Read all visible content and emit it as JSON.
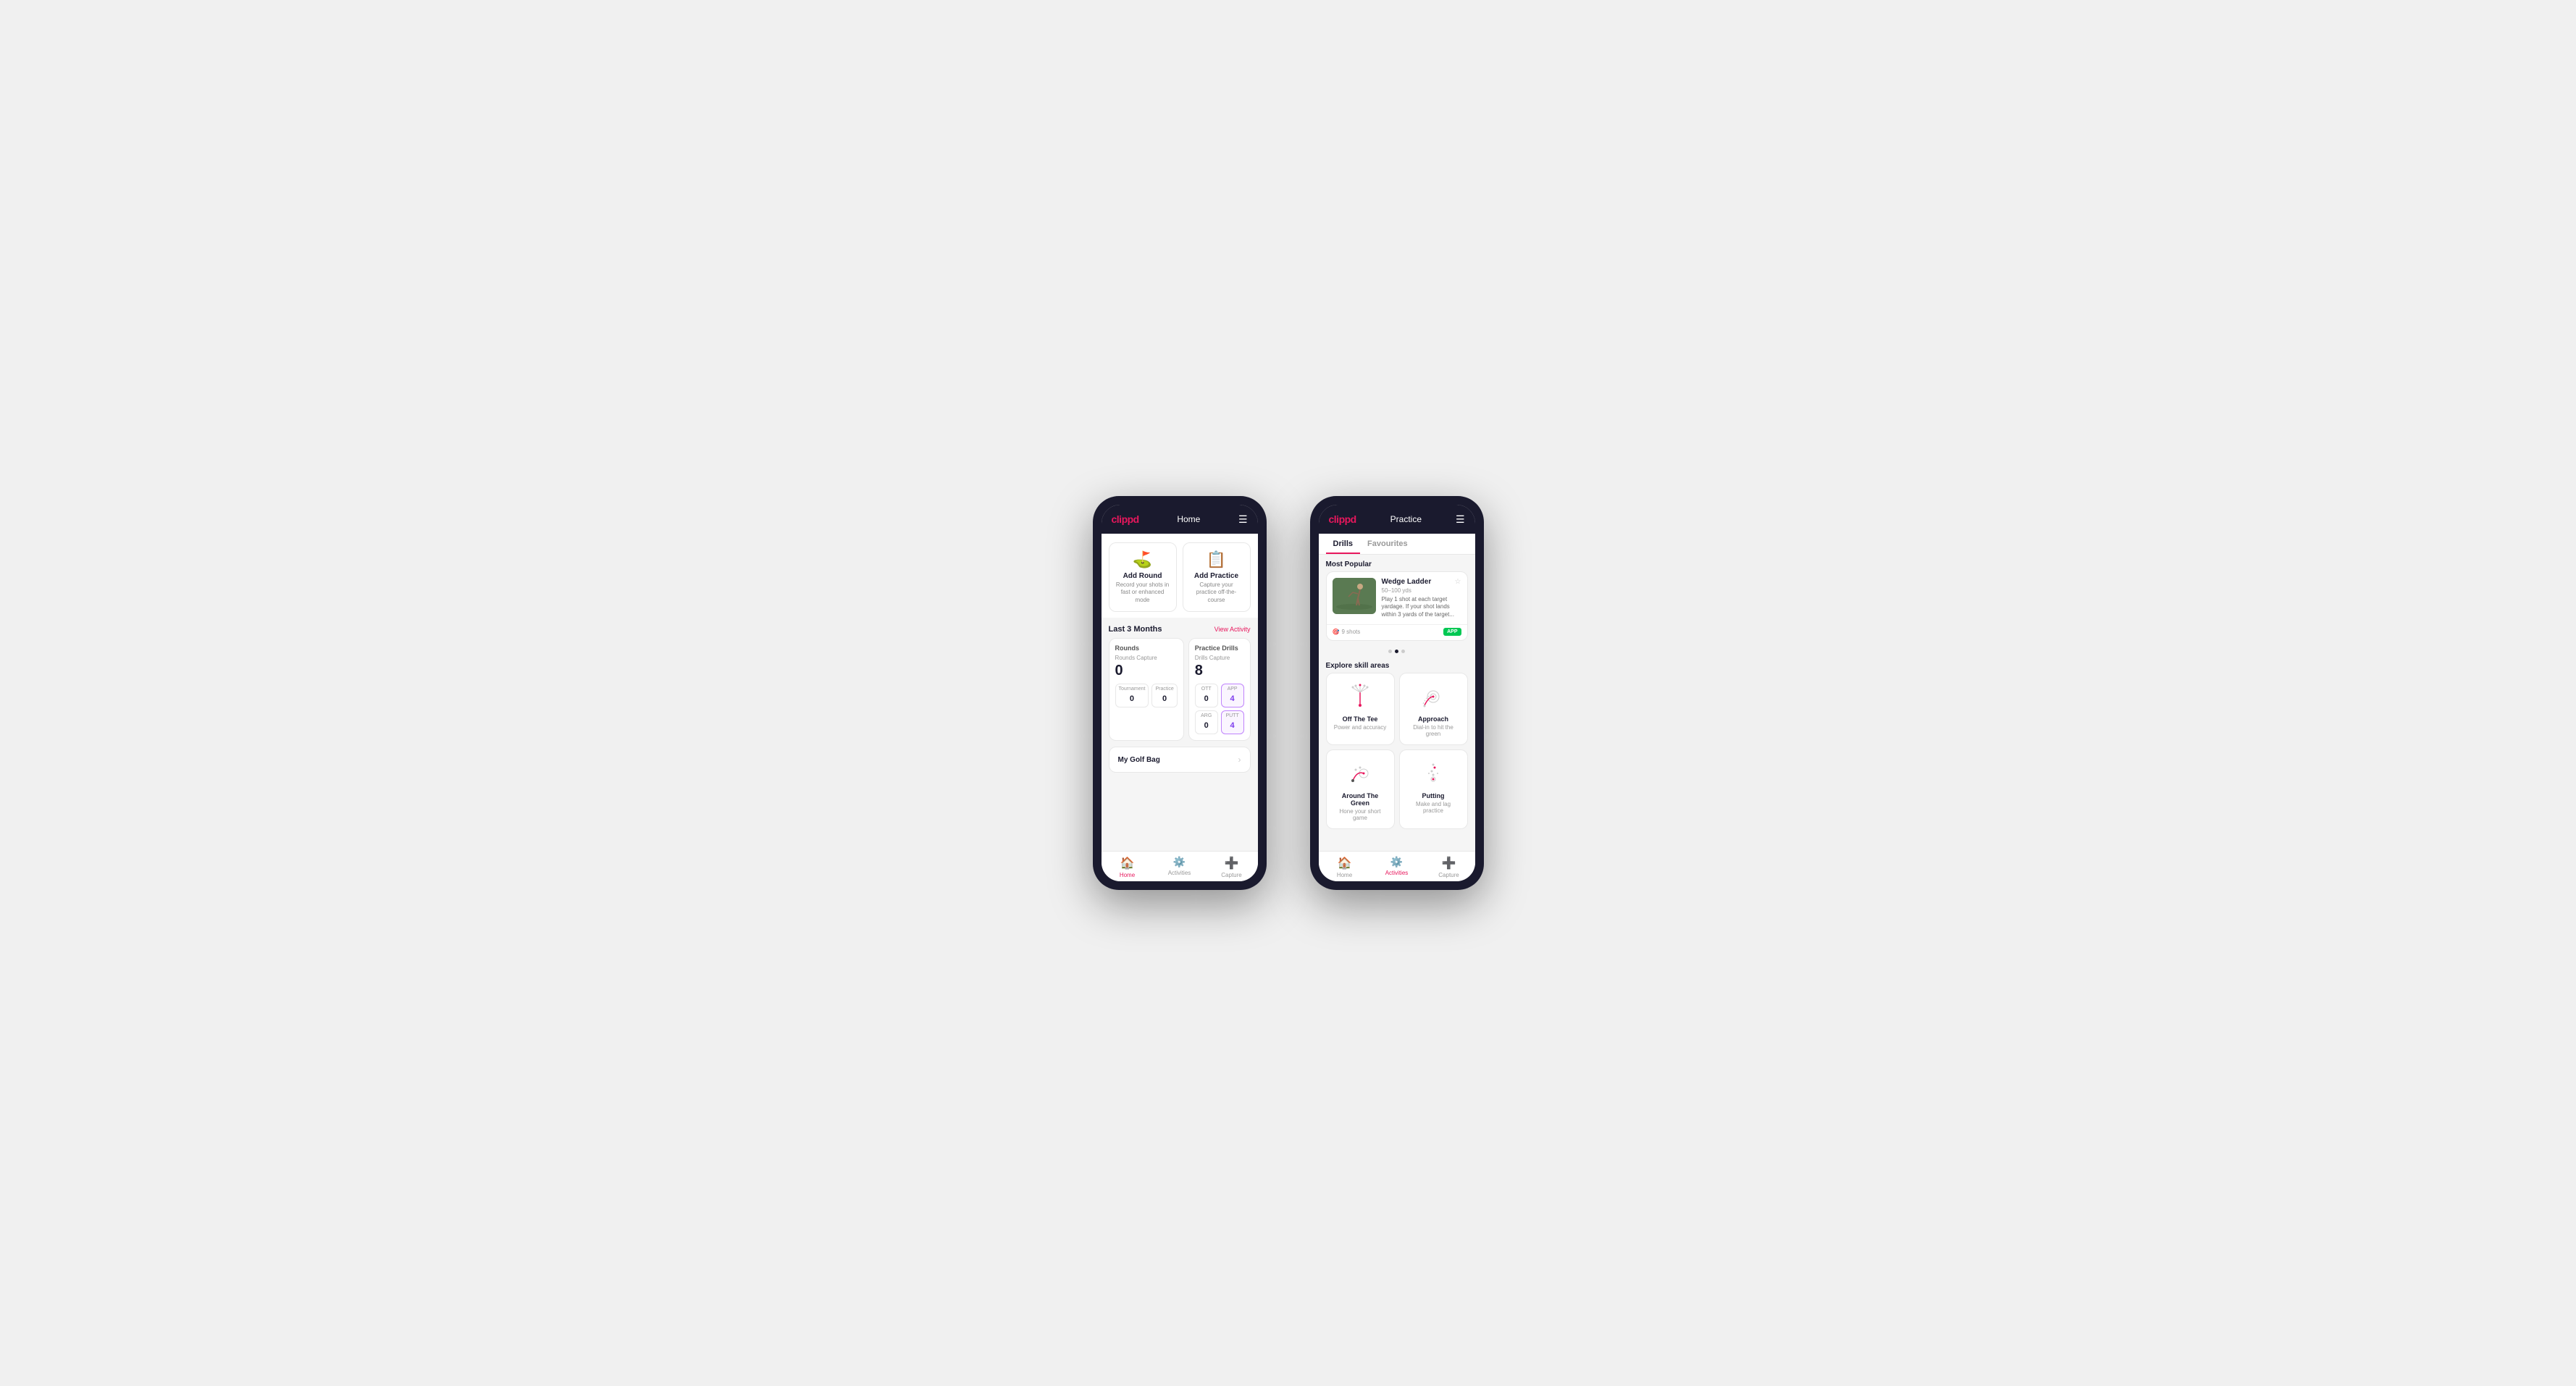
{
  "phone1": {
    "header": {
      "logo": "clippd",
      "title": "Home",
      "menu_label": "☰"
    },
    "action_cards": [
      {
        "id": "add-round",
        "icon": "⛳",
        "title": "Add Round",
        "description": "Record your shots in fast or enhanced mode"
      },
      {
        "id": "add-practice",
        "icon": "📋",
        "title": "Add Practice",
        "description": "Capture your practice off-the-course"
      }
    ],
    "stats_section": {
      "header": "Last 3 Months",
      "view_link": "View Activity",
      "rounds": {
        "title": "Rounds",
        "capture_label": "Rounds Capture",
        "total": "0",
        "tournament_label": "Tournament",
        "tournament_value": "0",
        "practice_label": "Practice",
        "practice_value": "0"
      },
      "practice_drills": {
        "title": "Practice Drills",
        "capture_label": "Drills Capture",
        "total": "8",
        "stats": [
          {
            "label": "OTT",
            "value": "0"
          },
          {
            "label": "APP",
            "value": "4",
            "highlighted": true
          },
          {
            "label": "ARG",
            "value": "0"
          },
          {
            "label": "PUTT",
            "value": "4",
            "highlighted": true
          }
        ]
      }
    },
    "golf_bag": {
      "label": "My Golf Bag",
      "chevron": "›"
    },
    "nav": [
      {
        "id": "home",
        "icon": "🏠",
        "label": "Home",
        "active": true
      },
      {
        "id": "activities",
        "icon": "⚙",
        "label": "Activities",
        "active": false
      },
      {
        "id": "capture",
        "icon": "➕",
        "label": "Capture",
        "active": false
      }
    ]
  },
  "phone2": {
    "header": {
      "logo": "clippd",
      "title": "Practice",
      "menu_label": "☰"
    },
    "tabs": [
      {
        "id": "drills",
        "label": "Drills",
        "active": true
      },
      {
        "id": "favourites",
        "label": "Favourites",
        "active": false
      }
    ],
    "most_popular": {
      "section_label": "Most Popular",
      "drill": {
        "name": "Wedge Ladder",
        "yardage": "50–100 yds",
        "description": "Play 1 shot at each target yardage. If your shot lands within 3 yards of the target...",
        "shots_label": "9 shots",
        "badge": "APP"
      },
      "dots": [
        false,
        true,
        false
      ]
    },
    "explore": {
      "section_label": "Explore skill areas",
      "skills": [
        {
          "id": "off-the-tee",
          "name": "Off The Tee",
          "description": "Power and accuracy",
          "icon_type": "tee"
        },
        {
          "id": "approach",
          "name": "Approach",
          "description": "Dial-in to hit the green",
          "icon_type": "approach"
        },
        {
          "id": "around-the-green",
          "name": "Around The Green",
          "description": "Hone your short game",
          "icon_type": "around-green"
        },
        {
          "id": "putting",
          "name": "Putting",
          "description": "Make and lag practice",
          "icon_type": "putting"
        }
      ]
    },
    "nav": [
      {
        "id": "home",
        "icon": "🏠",
        "label": "Home",
        "active": false
      },
      {
        "id": "activities",
        "icon": "⚙",
        "label": "Activities",
        "active": true
      },
      {
        "id": "capture",
        "icon": "➕",
        "label": "Capture",
        "active": false
      }
    ]
  }
}
